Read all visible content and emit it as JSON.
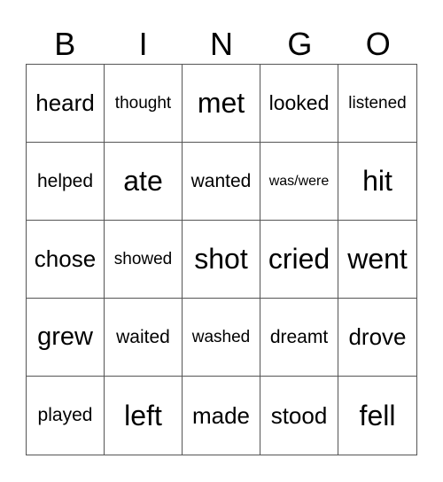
{
  "header": {
    "letters": [
      "B",
      "I",
      "N",
      "G",
      "O"
    ]
  },
  "grid": {
    "rows": [
      [
        "heard",
        "thought",
        "met",
        "looked",
        "listened"
      ],
      [
        "helped",
        "ate",
        "wanted",
        "was/were",
        "hit"
      ],
      [
        "chose",
        "showed",
        "shot",
        "cried",
        "went"
      ],
      [
        "grew",
        "waited",
        "washed",
        "dreamt",
        "drove"
      ],
      [
        "played",
        "left",
        "made",
        "stood",
        "fell"
      ]
    ]
  },
  "colors": {
    "border": "#555555",
    "text": "#000000",
    "background": "#ffffff"
  }
}
